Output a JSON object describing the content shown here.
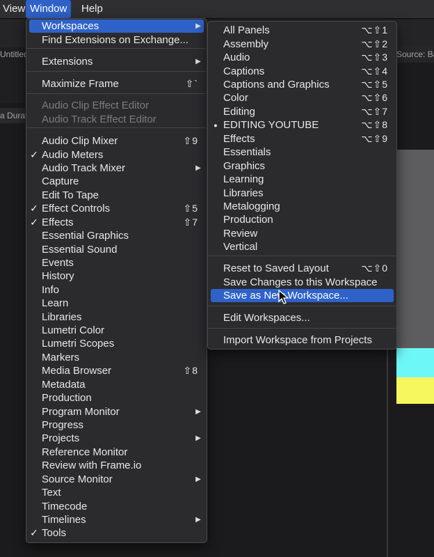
{
  "menubar": {
    "items": [
      "View",
      "Window",
      "Help"
    ],
    "active": "Window"
  },
  "background": {
    "untitled": "Untitled",
    "source": "Source: Bar",
    "duration": "a Durati"
  },
  "window_menu": {
    "items": [
      {
        "label": "Workspaces",
        "submenu": true,
        "highlighted": true
      },
      {
        "label": "Find Extensions on Exchange..."
      },
      {
        "label": "Extensions",
        "submenu": true
      },
      {
        "label": "Maximize Frame",
        "shortcut": "⇧`"
      },
      {
        "label": "Audio Clip Effect Editor",
        "disabled": true
      },
      {
        "label": "Audio Track Effect Editor",
        "disabled": true
      },
      {
        "label": "Audio Clip Mixer",
        "shortcut": "⇧9"
      },
      {
        "label": "Audio Meters",
        "checked": true
      },
      {
        "label": "Audio Track Mixer",
        "submenu": true
      },
      {
        "label": "Capture"
      },
      {
        "label": "Edit To Tape"
      },
      {
        "label": "Effect Controls",
        "checked": true,
        "shortcut": "⇧5"
      },
      {
        "label": "Effects",
        "checked": true,
        "shortcut": "⇧7"
      },
      {
        "label": "Essential Graphics"
      },
      {
        "label": "Essential Sound"
      },
      {
        "label": "Events"
      },
      {
        "label": "History"
      },
      {
        "label": "Info"
      },
      {
        "label": "Learn"
      },
      {
        "label": "Libraries"
      },
      {
        "label": "Lumetri Color"
      },
      {
        "label": "Lumetri Scopes"
      },
      {
        "label": "Markers"
      },
      {
        "label": "Media Browser",
        "shortcut": "⇧8"
      },
      {
        "label": "Metadata"
      },
      {
        "label": "Production"
      },
      {
        "label": "Program Monitor",
        "submenu": true
      },
      {
        "label": "Progress"
      },
      {
        "label": "Projects",
        "submenu": true
      },
      {
        "label": "Reference Monitor"
      },
      {
        "label": "Review with Frame.io"
      },
      {
        "label": "Source Monitor",
        "submenu": true
      },
      {
        "label": "Text"
      },
      {
        "label": "Timecode"
      },
      {
        "label": "Timelines",
        "submenu": true
      },
      {
        "label": "Tools",
        "checked": true
      }
    ]
  },
  "workspaces_menu": {
    "items": [
      {
        "label": "All Panels",
        "shortcut": "⌥⇧1"
      },
      {
        "label": "Assembly",
        "shortcut": "⌥⇧2"
      },
      {
        "label": "Audio",
        "shortcut": "⌥⇧3"
      },
      {
        "label": "Captions",
        "shortcut": "⌥⇧4"
      },
      {
        "label": "Captions and Graphics",
        "shortcut": "⌥⇧5"
      },
      {
        "label": "Color",
        "shortcut": "⌥⇧6"
      },
      {
        "label": "Editing",
        "shortcut": "⌥⇧7"
      },
      {
        "label": "EDITING YOUTUBE",
        "shortcut": "⌥⇧8",
        "current": true
      },
      {
        "label": "Effects",
        "shortcut": "⌥⇧9"
      },
      {
        "label": "Essentials"
      },
      {
        "label": "Graphics"
      },
      {
        "label": "Learning"
      },
      {
        "label": "Libraries"
      },
      {
        "label": "Metalogging"
      },
      {
        "label": "Production"
      },
      {
        "label": "Review"
      },
      {
        "label": "Vertical"
      },
      {
        "label": "Reset to Saved Layout",
        "shortcut": "⌥⇧0"
      },
      {
        "label": "Save Changes to this Workspace"
      },
      {
        "label": "Save as New Workspace...",
        "highlighted": true
      },
      {
        "label": "Edit Workspaces..."
      },
      {
        "label": "Import Workspace from Projects"
      }
    ]
  },
  "icons": {
    "check": "checkmark-icon",
    "bullet": "bullet-icon",
    "submenu": "submenu-arrow-icon",
    "cursor": "mouse-pointer-icon"
  },
  "colors": {
    "highlight": "#2f62c9",
    "menu_bg": "#2b2b2e",
    "cyan_bar": "#6ef7f7",
    "yellow_bar": "#f6f75c"
  }
}
